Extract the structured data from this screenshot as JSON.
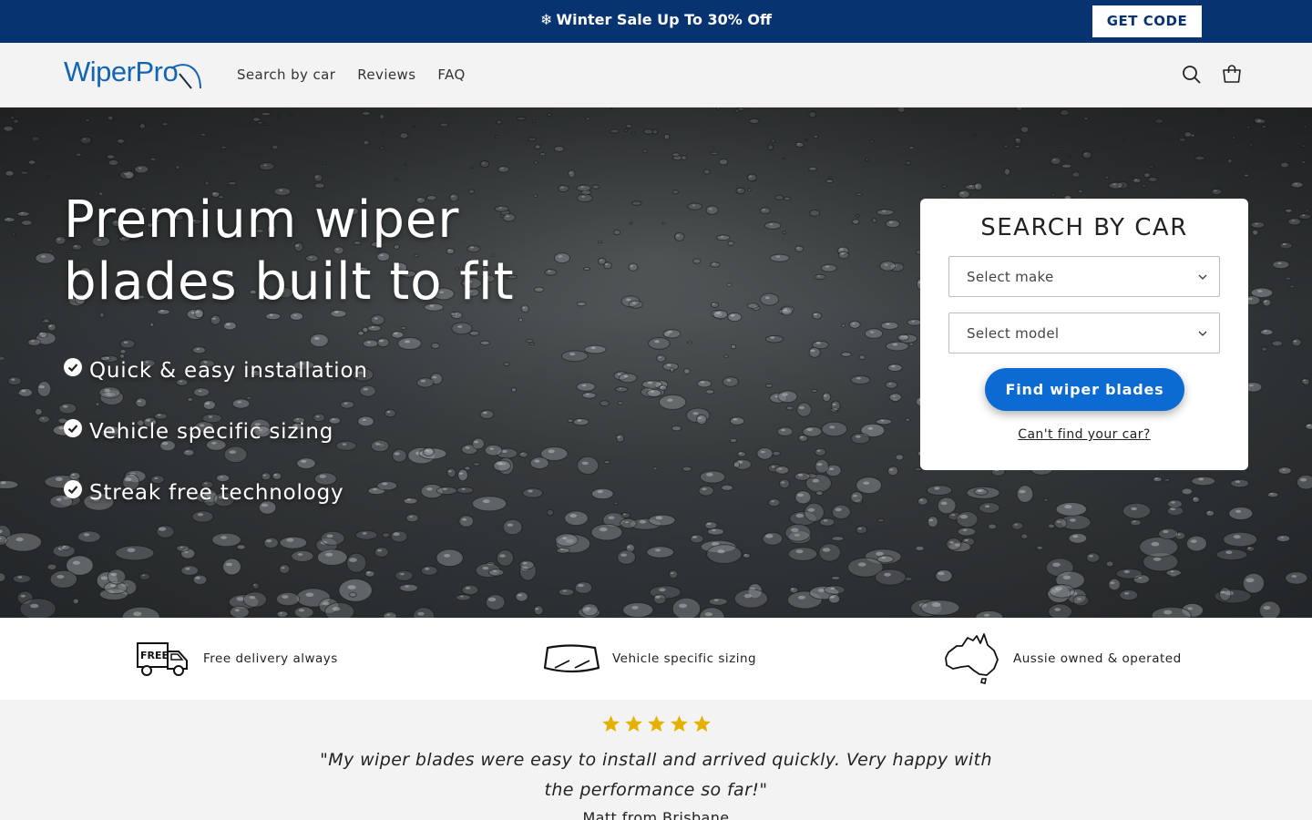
{
  "announcement": {
    "icon": "snowflake-icon",
    "text": "Winter Sale Up To 30% Off",
    "button_label": "GET CODE",
    "bg_color": "#073470"
  },
  "header": {
    "logo_text": "WiperPro",
    "nav": [
      "Search by car",
      "Reviews",
      "FAQ"
    ],
    "icons": [
      "search-icon",
      "cart-icon"
    ]
  },
  "hero": {
    "title": "Premium wiper blades built to fit",
    "features": [
      "Quick & easy installation",
      "Vehicle specific sizing",
      "Streak free technology"
    ]
  },
  "search_card": {
    "title": "SEARCH BY CAR",
    "make_placeholder": "Select make",
    "model_placeholder": "Select model",
    "button_label": "Find wiper blades",
    "help_link": "Can't find your car?",
    "accent_color": "#0c6ad3"
  },
  "benefits": [
    {
      "icon": "free-delivery-truck-icon",
      "text": "Free delivery always",
      "badge": "FREE"
    },
    {
      "icon": "windscreen-icon",
      "text": "Vehicle specific sizing"
    },
    {
      "icon": "australia-map-icon",
      "text": "Aussie owned & operated"
    }
  ],
  "review": {
    "rating": 5,
    "star_color": "#e5b100",
    "quote": "\"My wiper blades were easy to install and arrived quickly. Very happy with the performance so far!\"",
    "reviewer": "Matt from Brisbane"
  }
}
